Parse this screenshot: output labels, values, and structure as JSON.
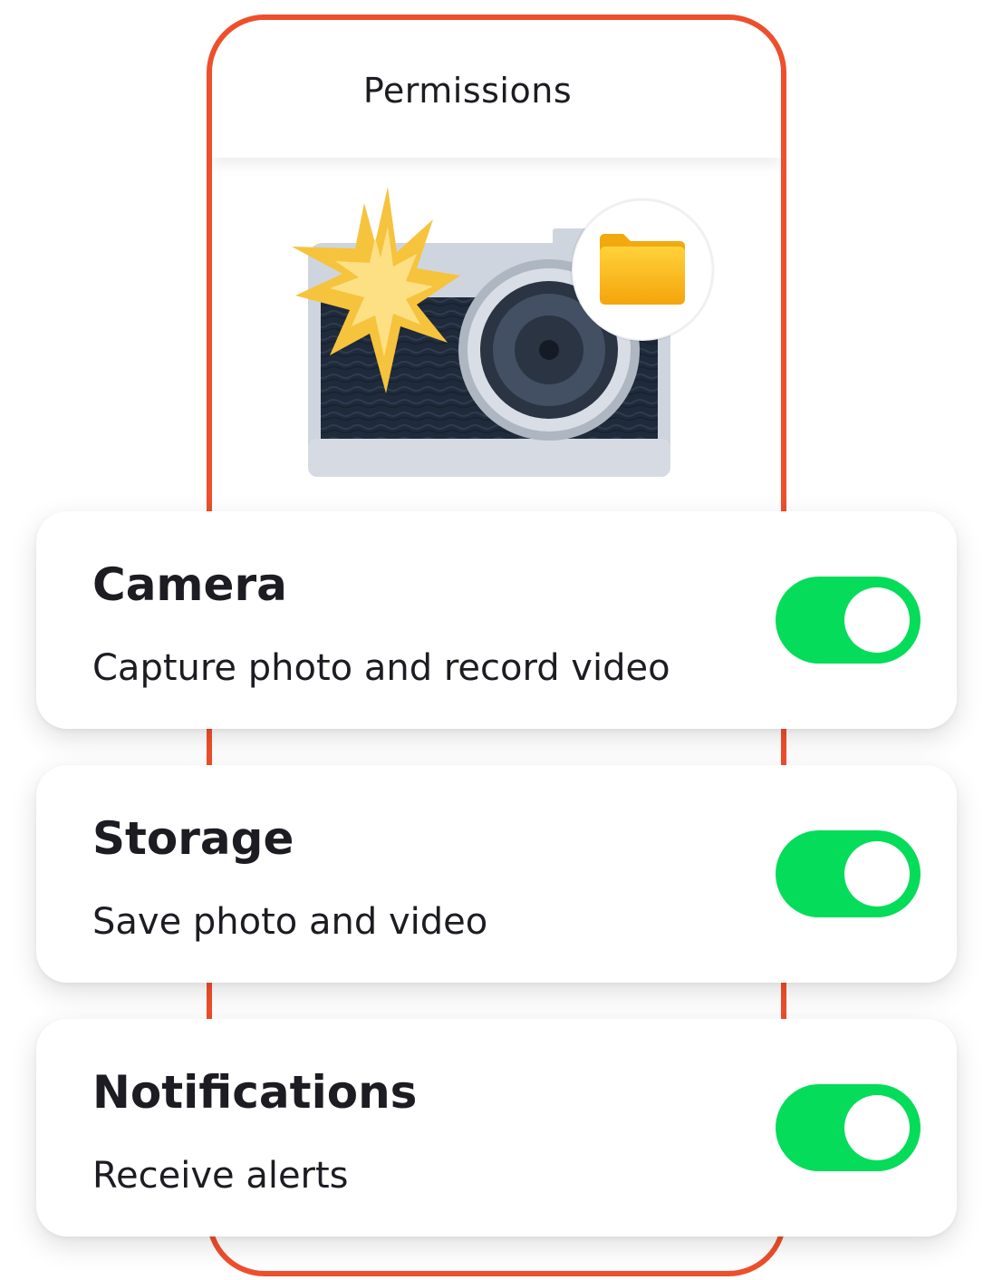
{
  "screen": {
    "title": "Permissions",
    "accent_color": "#ee4f2c"
  },
  "illustration": {
    "icons": [
      "camera-icon",
      "flash-icon",
      "folder-icon"
    ]
  },
  "permissions": [
    {
      "title": "Camera",
      "description": "Capture photo and record video",
      "enabled": true,
      "toggle_color": "#05dc5a"
    },
    {
      "title": "Storage",
      "description": "Save photo and video",
      "enabled": true,
      "toggle_color": "#05dc5a"
    },
    {
      "title": "Notifications",
      "description": "Receive alerts",
      "enabled": true,
      "toggle_color": "#05dc5a"
    }
  ]
}
